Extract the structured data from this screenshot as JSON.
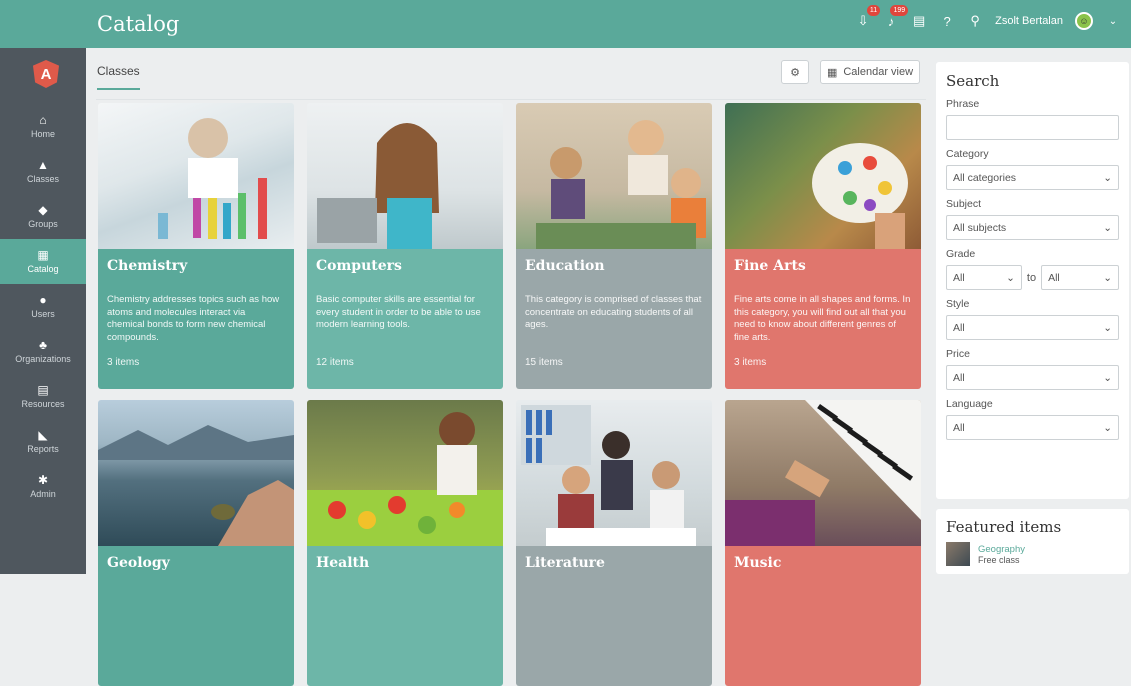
{
  "header": {
    "title": "Catalog",
    "badges": [
      "11",
      "199"
    ],
    "user_name": "Zsolt Bertalan",
    "icons": [
      "inbox-icon",
      "bell-icon",
      "message-icon",
      "help-icon",
      "search-icon",
      "user-avatar",
      "chevron-down-icon"
    ]
  },
  "sidebar": {
    "logo": "A",
    "items": [
      {
        "label": "Home",
        "icon": "⌂"
      },
      {
        "label": "Classes",
        "icon": "▲"
      },
      {
        "label": "Groups",
        "icon": "◆"
      },
      {
        "label": "Catalog",
        "icon": "▦",
        "active": true
      },
      {
        "label": "Users",
        "icon": "●"
      },
      {
        "label": "Organizations",
        "icon": "♣"
      },
      {
        "label": "Resources",
        "icon": "▤"
      },
      {
        "label": "Reports",
        "icon": "◣"
      },
      {
        "label": "Admin",
        "icon": "✱"
      }
    ]
  },
  "main": {
    "tab": "Classes",
    "calendar_view": "Calendar view",
    "cards": [
      {
        "title": "Chemistry",
        "desc": "Chemistry addresses topics such as how atoms and molecules interact via chemical bonds to form new chemical compounds.",
        "count": "3 items",
        "color": "#5aa99a"
      },
      {
        "title": "Computers",
        "desc": "Basic computer skills are essential for every student in order to be able to use modern learning tools.",
        "count": "12 items",
        "color": "#6db6a8"
      },
      {
        "title": "Education",
        "desc": "This category is comprised of classes that concentrate on educating students of all ages.",
        "count": "15 items",
        "color": "#9aa7a9"
      },
      {
        "title": "Fine Arts",
        "desc": "Fine arts come in all shapes and forms. In this category, you will find out all that you need to know about different genres of fine arts.",
        "count": "3 items",
        "color": "#e0766d"
      },
      {
        "title": "Geology",
        "desc": "",
        "count": "",
        "color": "#5aa99a"
      },
      {
        "title": "Health",
        "desc": "",
        "count": "",
        "color": "#6db6a8"
      },
      {
        "title": "Literature",
        "desc": "",
        "count": "",
        "color": "#9aa7a9"
      },
      {
        "title": "Music",
        "desc": "",
        "count": "",
        "color": "#e0766d"
      }
    ]
  },
  "search": {
    "title": "Search",
    "phrase_label": "Phrase",
    "phrase_value": "",
    "category_label": "Category",
    "category_value": "All categories",
    "subject_label": "Subject",
    "subject_value": "All subjects",
    "grade_label": "Grade",
    "grade_from": "All",
    "grade_to_label": "to",
    "grade_to": "All",
    "style_label": "Style",
    "style_value": "All",
    "price_label": "Price",
    "price_value": "All",
    "language_label": "Language",
    "language_value": "All"
  },
  "featured": {
    "title": "Featured items",
    "item_name": "Geography",
    "item_sub": "Free class"
  }
}
